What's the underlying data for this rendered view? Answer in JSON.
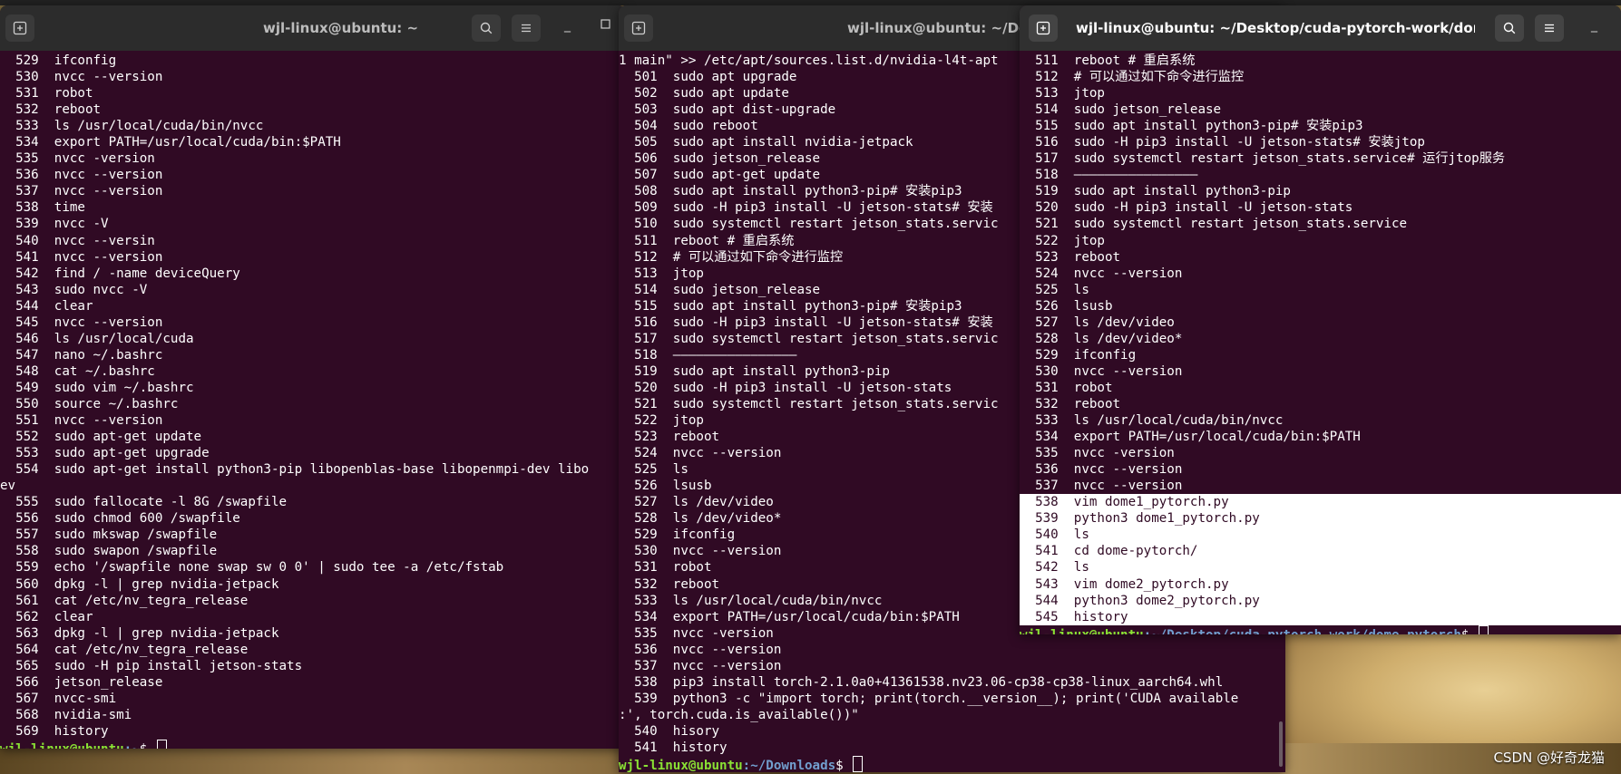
{
  "windows": {
    "left": {
      "title": "wjl-linux@ubuntu: ~",
      "lines": [
        "  529  ifconfig",
        "  530  nvcc --version",
        "  531  robot",
        "  532  reboot",
        "  533  ls /usr/local/cuda/bin/nvcc",
        "  534  export PATH=/usr/local/cuda/bin:$PATH",
        "  535  nvcc -version",
        "  536  nvcc --version",
        "  537  nvcc --version",
        "  538  time",
        "  539  nvcc -V",
        "  540  nvcc --versin",
        "  541  nvcc --version",
        "  542  find / -name deviceQuery",
        "  543  sudo nvcc -V",
        "  544  clear",
        "  545  nvcc --version",
        "  546  ls /usr/local/cuda",
        "  547  nano ~/.bashrc",
        "  548  cat ~/.bashrc",
        "  549  sudo vim ~/.bashrc",
        "  550  source ~/.bashrc",
        "  551  nvcc --version",
        "  552  sudo apt-get update",
        "  553  sudo apt-get upgrade",
        "  554  sudo apt-get install python3-pip libopenblas-base libopenmpi-dev libo",
        "ev",
        "  555  sudo fallocate -l 8G /swapfile",
        "  556  sudo chmod 600 /swapfile",
        "  557  sudo mkswap /swapfile",
        "  558  sudo swapon /swapfile",
        "  559  echo '/swapfile none swap sw 0 0' | sudo tee -a /etc/fstab",
        "  560  dpkg -l | grep nvidia-jetpack",
        "  561  cat /etc/nv_tegra_release",
        "  562  clear",
        "  563  dpkg -l | grep nvidia-jetpack",
        "  564  cat /etc/nv_tegra_release",
        "  565  sudo -H pip install jetson-stats",
        "  566  jetson_release",
        "  567  nvcc-smi",
        "  568  nvidia-smi",
        "  569  history"
      ],
      "prompt_user": "wjl-linux@ubuntu",
      "prompt_path": ":~",
      "prompt_end": "$ "
    },
    "middle": {
      "title": "wjl-linux@ubuntu: ~/Down",
      "lines": [
        "1 main\" >> /etc/apt/sources.list.d/nvidia-l4t-apt",
        "  501  sudo apt upgrade",
        "  502  sudo apt update",
        "  503  sudo apt dist-upgrade",
        "  504  sudo reboot",
        "  505  sudo apt install nvidia-jetpack",
        "  506  sudo jetson_release",
        "  507  sudo apt-get update",
        "  508  sudo apt install python3-pip# 安装pip3",
        "  509  sudo -H pip3 install -U jetson-stats# 安装",
        "  510  sudo systemctl restart jetson_stats.servic",
        "  511  reboot # 重启系统",
        "  512  # 可以通过如下命令进行监控",
        "  513  jtop",
        "  514  sudo jetson_release",
        "  515  sudo apt install python3-pip# 安装pip3",
        "  516  sudo -H pip3 install -U jetson-stats# 安装",
        "  517  sudo systemctl restart jetson_stats.servic",
        "  518  ————————————————",
        "  519  sudo apt install python3-pip",
        "  520  sudo -H pip3 install -U jetson-stats",
        "  521  sudo systemctl restart jetson_stats.servic",
        "  522  jtop",
        "  523  reboot",
        "  524  nvcc --version",
        "  525  ls",
        "  526  lsusb",
        "  527  ls /dev/video",
        "  528  ls /dev/video*",
        "  529  ifconfig",
        "  530  nvcc --version",
        "  531  robot",
        "  532  reboot",
        "  533  ls /usr/local/cuda/bin/nvcc",
        "  534  export PATH=/usr/local/cuda/bin:$PATH",
        "  535  nvcc -version",
        "  536  nvcc --version",
        "  537  nvcc --version",
        "  538  pip3 install torch-2.1.0a0+41361538.nv23.06-cp38-cp38-linux_aarch64.whl",
        "  539  python3 -c \"import torch; print(torch.__version__); print('CUDA available",
        ":', torch.cuda.is_available())\"",
        "  540  hisory",
        "  541  history"
      ],
      "prompt_user": "wjl-linux@ubuntu",
      "prompt_path": ":~/Downloads",
      "prompt_end": "$ "
    },
    "right": {
      "title": "wjl-linux@ubuntu: ~/Desktop/cuda-pytorch-work/dome-pyto...",
      "lines_top": [
        "  511  reboot # 重启系统",
        "  512  # 可以通过如下命令进行监控",
        "  513  jtop",
        "  514  sudo jetson_release",
        "  515  sudo apt install python3-pip# 安装pip3",
        "  516  sudo -H pip3 install -U jetson-stats# 安装jtop",
        "  517  sudo systemctl restart jetson_stats.service# 运行jtop服务",
        "  518  ————————————————",
        "  519  sudo apt install python3-pip",
        "  520  sudo -H pip3 install -U jetson-stats",
        "  521  sudo systemctl restart jetson_stats.service",
        "  522  jtop",
        "  523  reboot",
        "  524  nvcc --version",
        "  525  ls",
        "  526  lsusb",
        "  527  ls /dev/video",
        "  528  ls /dev/video*",
        "  529  ifconfig",
        "  530  nvcc --version",
        "  531  robot",
        "  532  reboot",
        "  533  ls /usr/local/cuda/bin/nvcc",
        "  534  export PATH=/usr/local/cuda/bin:$PATH",
        "  535  nvcc -version",
        "  536  nvcc --version",
        "  537  nvcc --version"
      ],
      "lines_selected": [
        "  538  vim dome1_pytorch.py",
        "  539  python3 dome1_pytorch.py",
        "  540  ls",
        "  541  cd dome-pytorch/",
        "  542  ls",
        "  543  vim dome2_pytorch.py",
        "  544  python3 dome2_pytorch.py",
        "  545  history"
      ],
      "prompt_user": "wjl-linux@ubuntu",
      "prompt_path": ":~/Desktop/cuda-pytorch-work/dome-pytorch",
      "prompt_end": "$ "
    }
  },
  "icons": {
    "new_tab": "new-tab-icon",
    "search": "search-icon",
    "menu": "hamburger-menu-icon",
    "minimize": "minimize-icon",
    "maximize": "maximize-icon"
  },
  "watermark": "CSDN @好奇龙猫",
  "colors": {
    "terminal_bg": "#300a24",
    "prompt_user": "#8ae234",
    "prompt_path": "#729fcf"
  }
}
